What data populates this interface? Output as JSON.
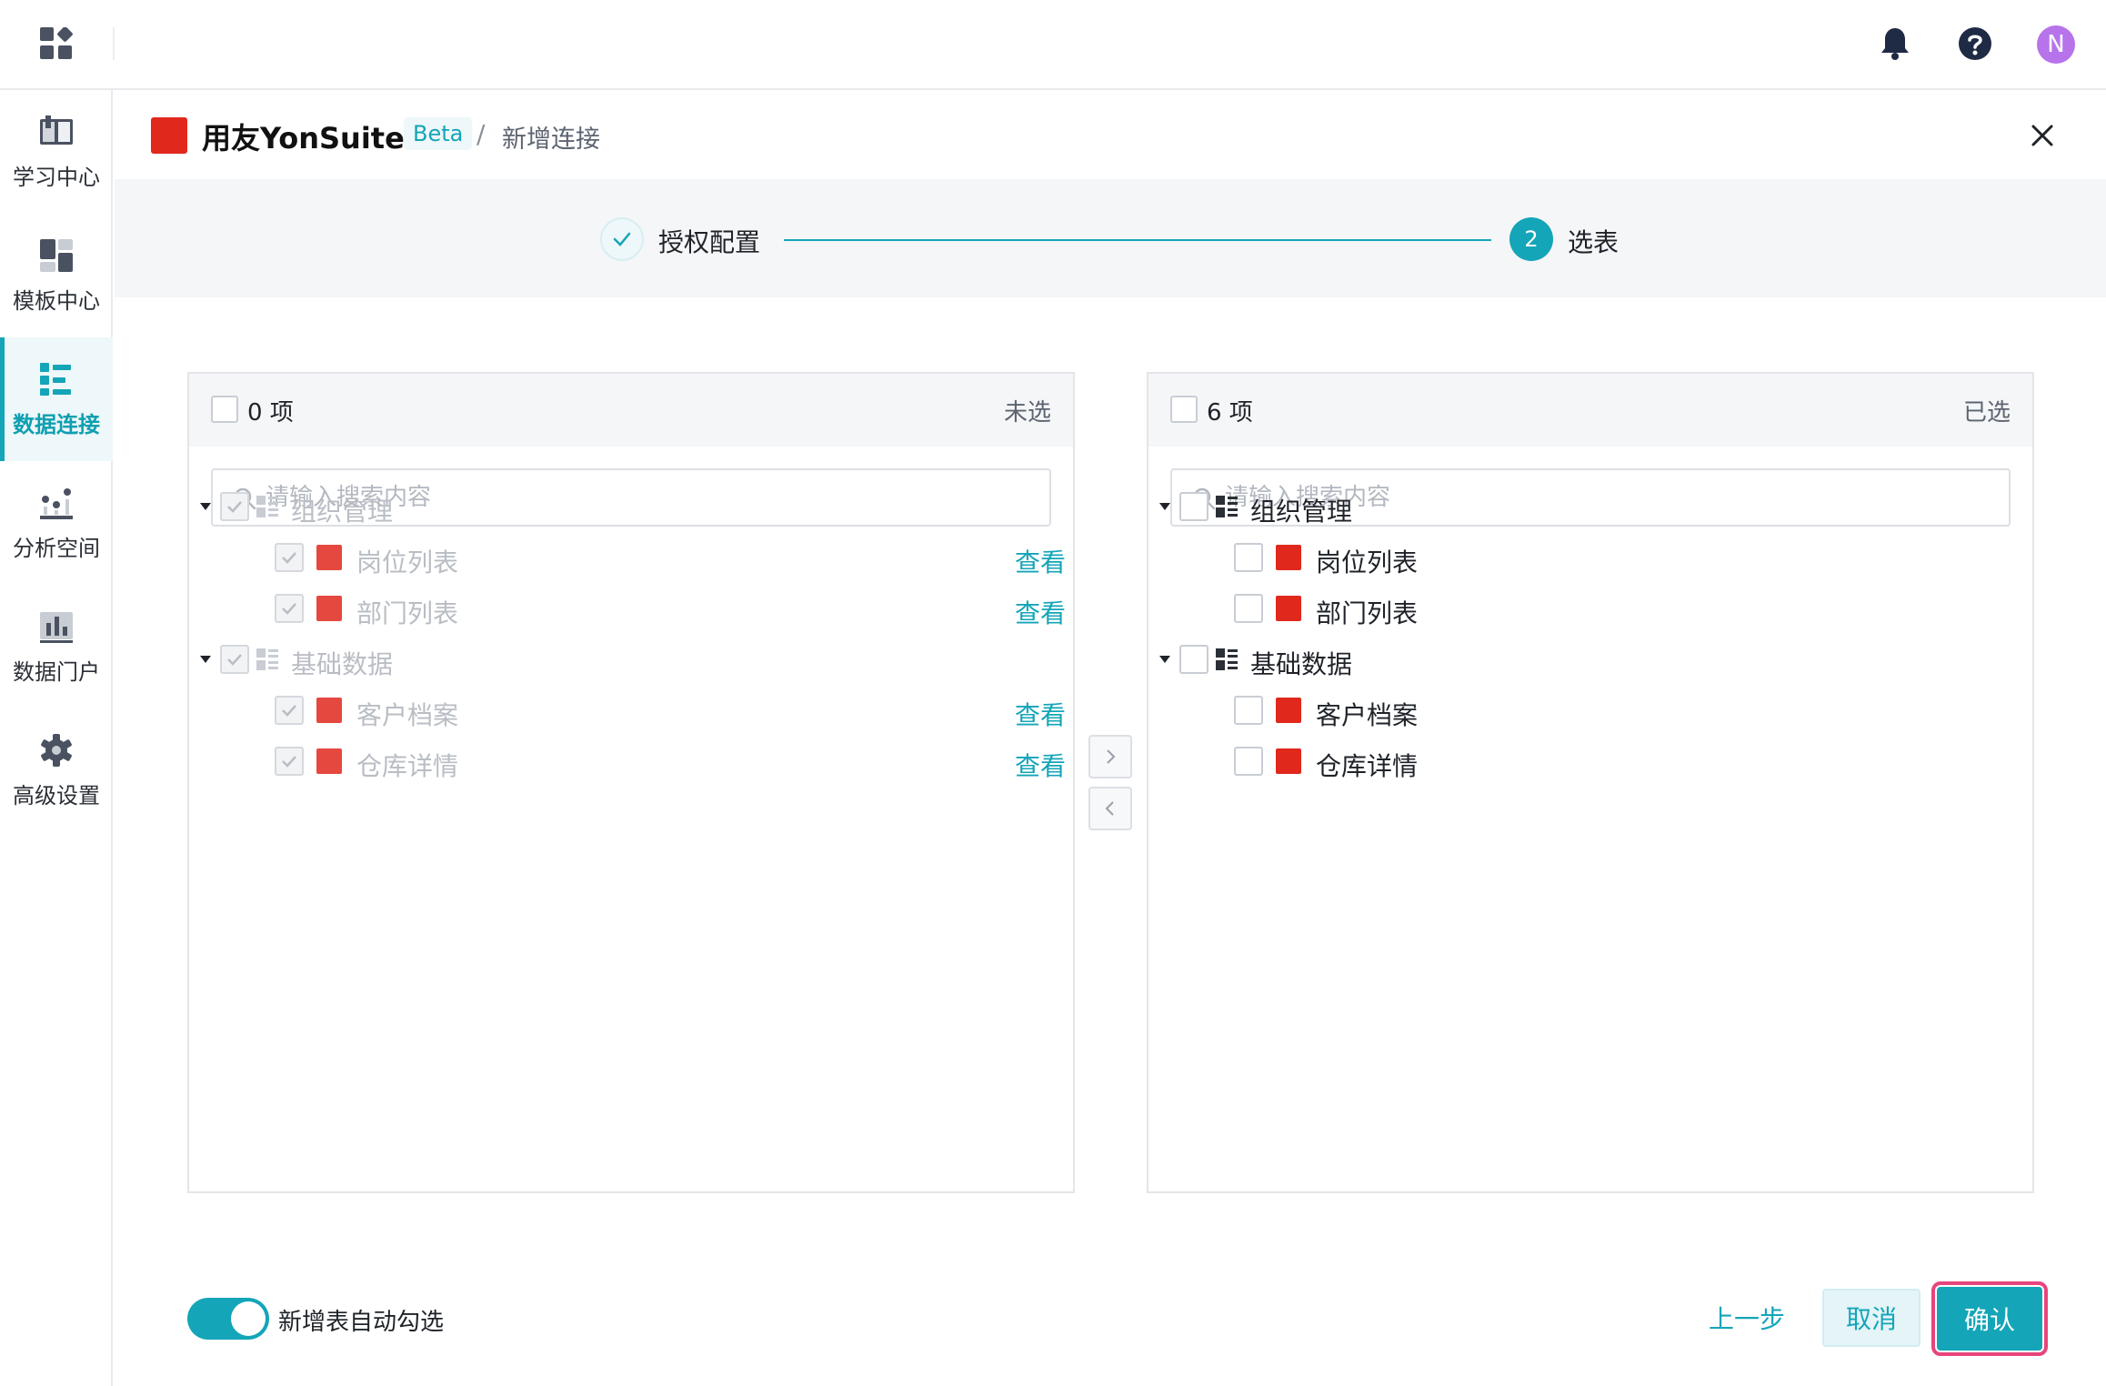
{
  "topbar": {
    "avatar_letter": "N",
    "icons": [
      "apps-icon",
      "bell-icon",
      "help-icon"
    ]
  },
  "sidebar": {
    "items": [
      {
        "label": "学习中心",
        "icon": "book-icon",
        "active": false
      },
      {
        "label": "模板中心",
        "icon": "template-icon",
        "active": false
      },
      {
        "label": "数据连接",
        "icon": "data-connect-icon",
        "active": true
      },
      {
        "label": "分析空间",
        "icon": "scatter-chart-icon",
        "active": false
      },
      {
        "label": "数据门户",
        "icon": "bar-chart-icon",
        "active": false
      },
      {
        "label": "高级设置",
        "icon": "gear-icon",
        "active": false
      }
    ],
    "accent_color": "#14a5b8"
  },
  "header": {
    "brand_title": "用友YonSuite",
    "beta_label": "Beta",
    "breadcrumb_sep": "/",
    "breadcrumb_current": "新增连接"
  },
  "steps": {
    "step1_label": "授权配置",
    "step2_number": "2",
    "step2_label": "选表"
  },
  "left_panel": {
    "count": "0 项",
    "status": "未选",
    "search_placeholder": "请输入搜索内容",
    "view_label": "查看",
    "groups": [
      {
        "label": "组织管理",
        "items": [
          "岗位列表",
          "部门列表"
        ]
      },
      {
        "label": "基础数据",
        "items": [
          "客户档案",
          "仓库详情"
        ]
      }
    ]
  },
  "right_panel": {
    "count": "6 项",
    "status": "已选",
    "search_placeholder": "请输入搜索内容",
    "groups": [
      {
        "label": "组织管理",
        "items": [
          "岗位列表",
          "部门列表"
        ]
      },
      {
        "label": "基础数据",
        "items": [
          "客户档案",
          "仓库详情"
        ]
      }
    ]
  },
  "transfer": {
    "to_right": ">",
    "to_left": "<"
  },
  "footer": {
    "toggle_label": "新增表自动勾选",
    "toggle_on": true,
    "prev_label": "上一步",
    "cancel_label": "取消",
    "confirm_label": "确认"
  }
}
